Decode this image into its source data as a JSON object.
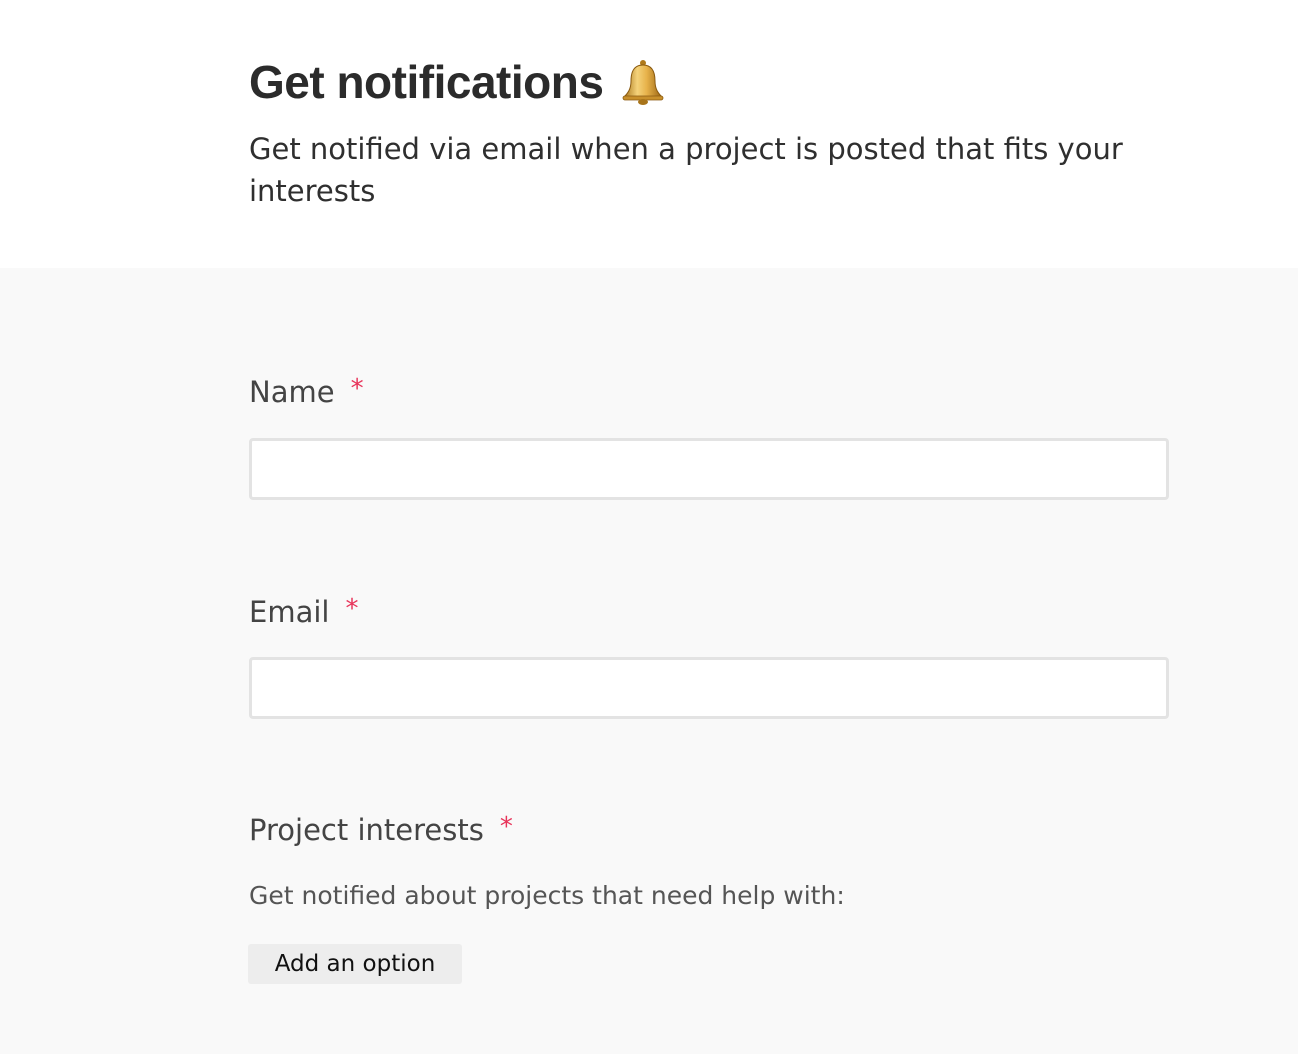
{
  "header": {
    "title": "Get notifications",
    "title_icon": "bell-icon",
    "subtitle": "Get notified via email when a project is posted that fits your interests"
  },
  "form": {
    "name": {
      "label": "Name",
      "required_marker": "*",
      "value": ""
    },
    "email": {
      "label": "Email",
      "required_marker": "*",
      "value": ""
    },
    "project_interests": {
      "label": "Project interests",
      "required_marker": "*",
      "help_text": "Get notified about projects that need help with:",
      "add_option_label": "Add an option"
    }
  },
  "colors": {
    "required_star": "#e8345a",
    "form_background": "#f9f9f9",
    "input_border": "#e3e3e3",
    "button_background": "#ededed"
  }
}
